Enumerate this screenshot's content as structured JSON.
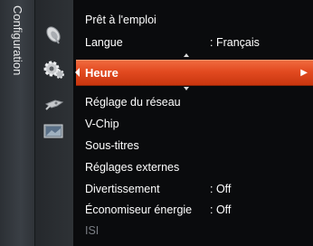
{
  "section": {
    "label": "Configuration"
  },
  "icons": [
    "satellite-dish-icon",
    "settings-gear-icon",
    "input-remote-icon",
    "application-image-icon"
  ],
  "menu": {
    "items": [
      {
        "label": "Prêt à l'emploi",
        "value": ""
      },
      {
        "label": "Langue",
        "value": ": Français"
      },
      {
        "label": "Heure",
        "value": "",
        "selected": true
      },
      {
        "label": "Réglage du réseau",
        "value": ""
      },
      {
        "label": "V-Chip",
        "value": ""
      },
      {
        "label": "Sous-titres",
        "value": ""
      },
      {
        "label": "Réglages externes",
        "value": ""
      },
      {
        "label": "Divertissement",
        "value": ": Off"
      },
      {
        "label": "Économiseur énergie",
        "value": ": Off"
      },
      {
        "label": "ISI",
        "value": "",
        "disabled": true
      }
    ],
    "submenu_arrow": "▶"
  },
  "colors": {
    "highlight": "#e24a20",
    "background": "#0a0b0d",
    "disabled_text": "#7a7e84"
  }
}
